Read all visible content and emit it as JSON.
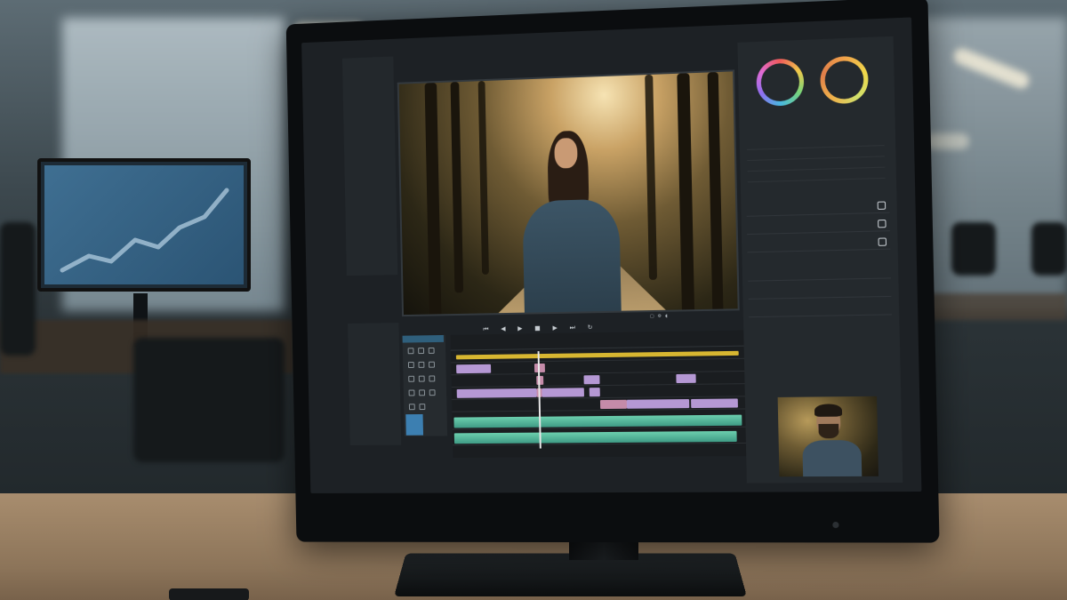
{
  "app": {
    "menu": [
      "",
      "",
      ""
    ]
  },
  "left_panel": {
    "items": [
      "",
      "",
      "",
      "",
      "",
      "",
      ""
    ]
  },
  "bin_panel": {
    "items": [
      "",
      "",
      "",
      ""
    ]
  },
  "transport_icons": [
    "skip-back-icon",
    "step-back-icon",
    "play-icon",
    "stop-icon",
    "step-forward-icon",
    "skip-forward-icon",
    "loop-icon"
  ],
  "timeline": {
    "ruler_labels": [
      "",
      "",
      "",
      "",
      ""
    ]
  },
  "right_panel": {
    "header": "",
    "wheels": [
      "lift-color-wheel",
      "gain-color-wheel"
    ],
    "effects": [
      "",
      "",
      ""
    ],
    "inspector_header": "",
    "inspector_labels": [
      "",
      "",
      "",
      "",
      ""
    ]
  }
}
